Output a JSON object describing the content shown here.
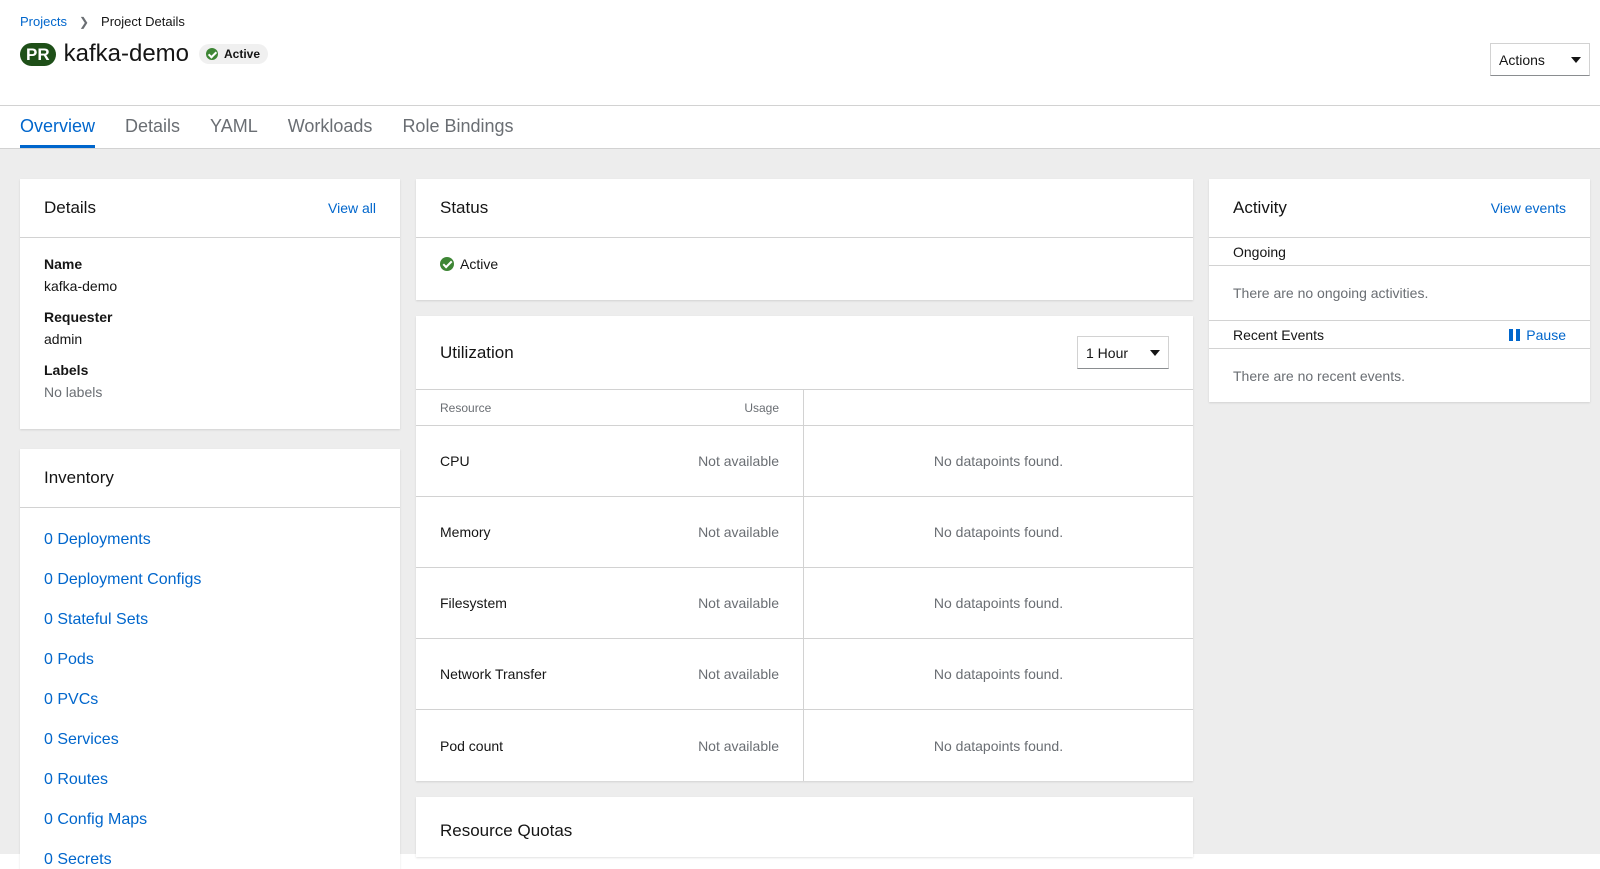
{
  "breadcrumb": {
    "parent": "Projects",
    "current": "Project Details"
  },
  "header": {
    "badge": "PR",
    "title": "kafka-demo",
    "status": "Active",
    "actions_label": "Actions"
  },
  "tabs": [
    {
      "label": "Overview"
    },
    {
      "label": "Details"
    },
    {
      "label": "YAML"
    },
    {
      "label": "Workloads"
    },
    {
      "label": "Role Bindings"
    }
  ],
  "details_card": {
    "title": "Details",
    "view_all": "View all",
    "name_label": "Name",
    "name_value": "kafka-demo",
    "requester_label": "Requester",
    "requester_value": "admin",
    "labels_label": "Labels",
    "labels_value": "No labels"
  },
  "inventory_card": {
    "title": "Inventory",
    "items": [
      "0 Deployments",
      "0 Deployment Configs",
      "0 Stateful Sets",
      "0 Pods",
      "0 PVCs",
      "0 Services",
      "0 Routes",
      "0 Config Maps",
      "0 Secrets"
    ]
  },
  "status_card": {
    "title": "Status",
    "value": "Active"
  },
  "utilization_card": {
    "title": "Utilization",
    "range": "1 Hour",
    "col_resource": "Resource",
    "col_usage": "Usage",
    "rows": [
      {
        "name": "CPU",
        "usage": "Not available",
        "chart": "No datapoints found."
      },
      {
        "name": "Memory",
        "usage": "Not available",
        "chart": "No datapoints found."
      },
      {
        "name": "Filesystem",
        "usage": "Not available",
        "chart": "No datapoints found."
      },
      {
        "name": "Network Transfer",
        "usage": "Not available",
        "chart": "No datapoints found."
      },
      {
        "name": "Pod count",
        "usage": "Not available",
        "chart": "No datapoints found."
      }
    ]
  },
  "quotas_card": {
    "title": "Resource Quotas"
  },
  "activity_card": {
    "title": "Activity",
    "view_events": "View events",
    "ongoing_label": "Ongoing",
    "ongoing_msg": "There are no ongoing activities.",
    "recent_label": "Recent Events",
    "pause_label": "Pause",
    "recent_msg": "There are no recent events."
  },
  "colors": {
    "link": "#0066cc",
    "ok": "#3e8635",
    "badge": "#1e4f18",
    "bg": "#ededed"
  },
  "icons": {
    "breadcrumb_sep": "chevron-right-icon",
    "status": "check-circle-icon",
    "dropdown": "caret-down-icon",
    "pause": "pause-icon"
  }
}
